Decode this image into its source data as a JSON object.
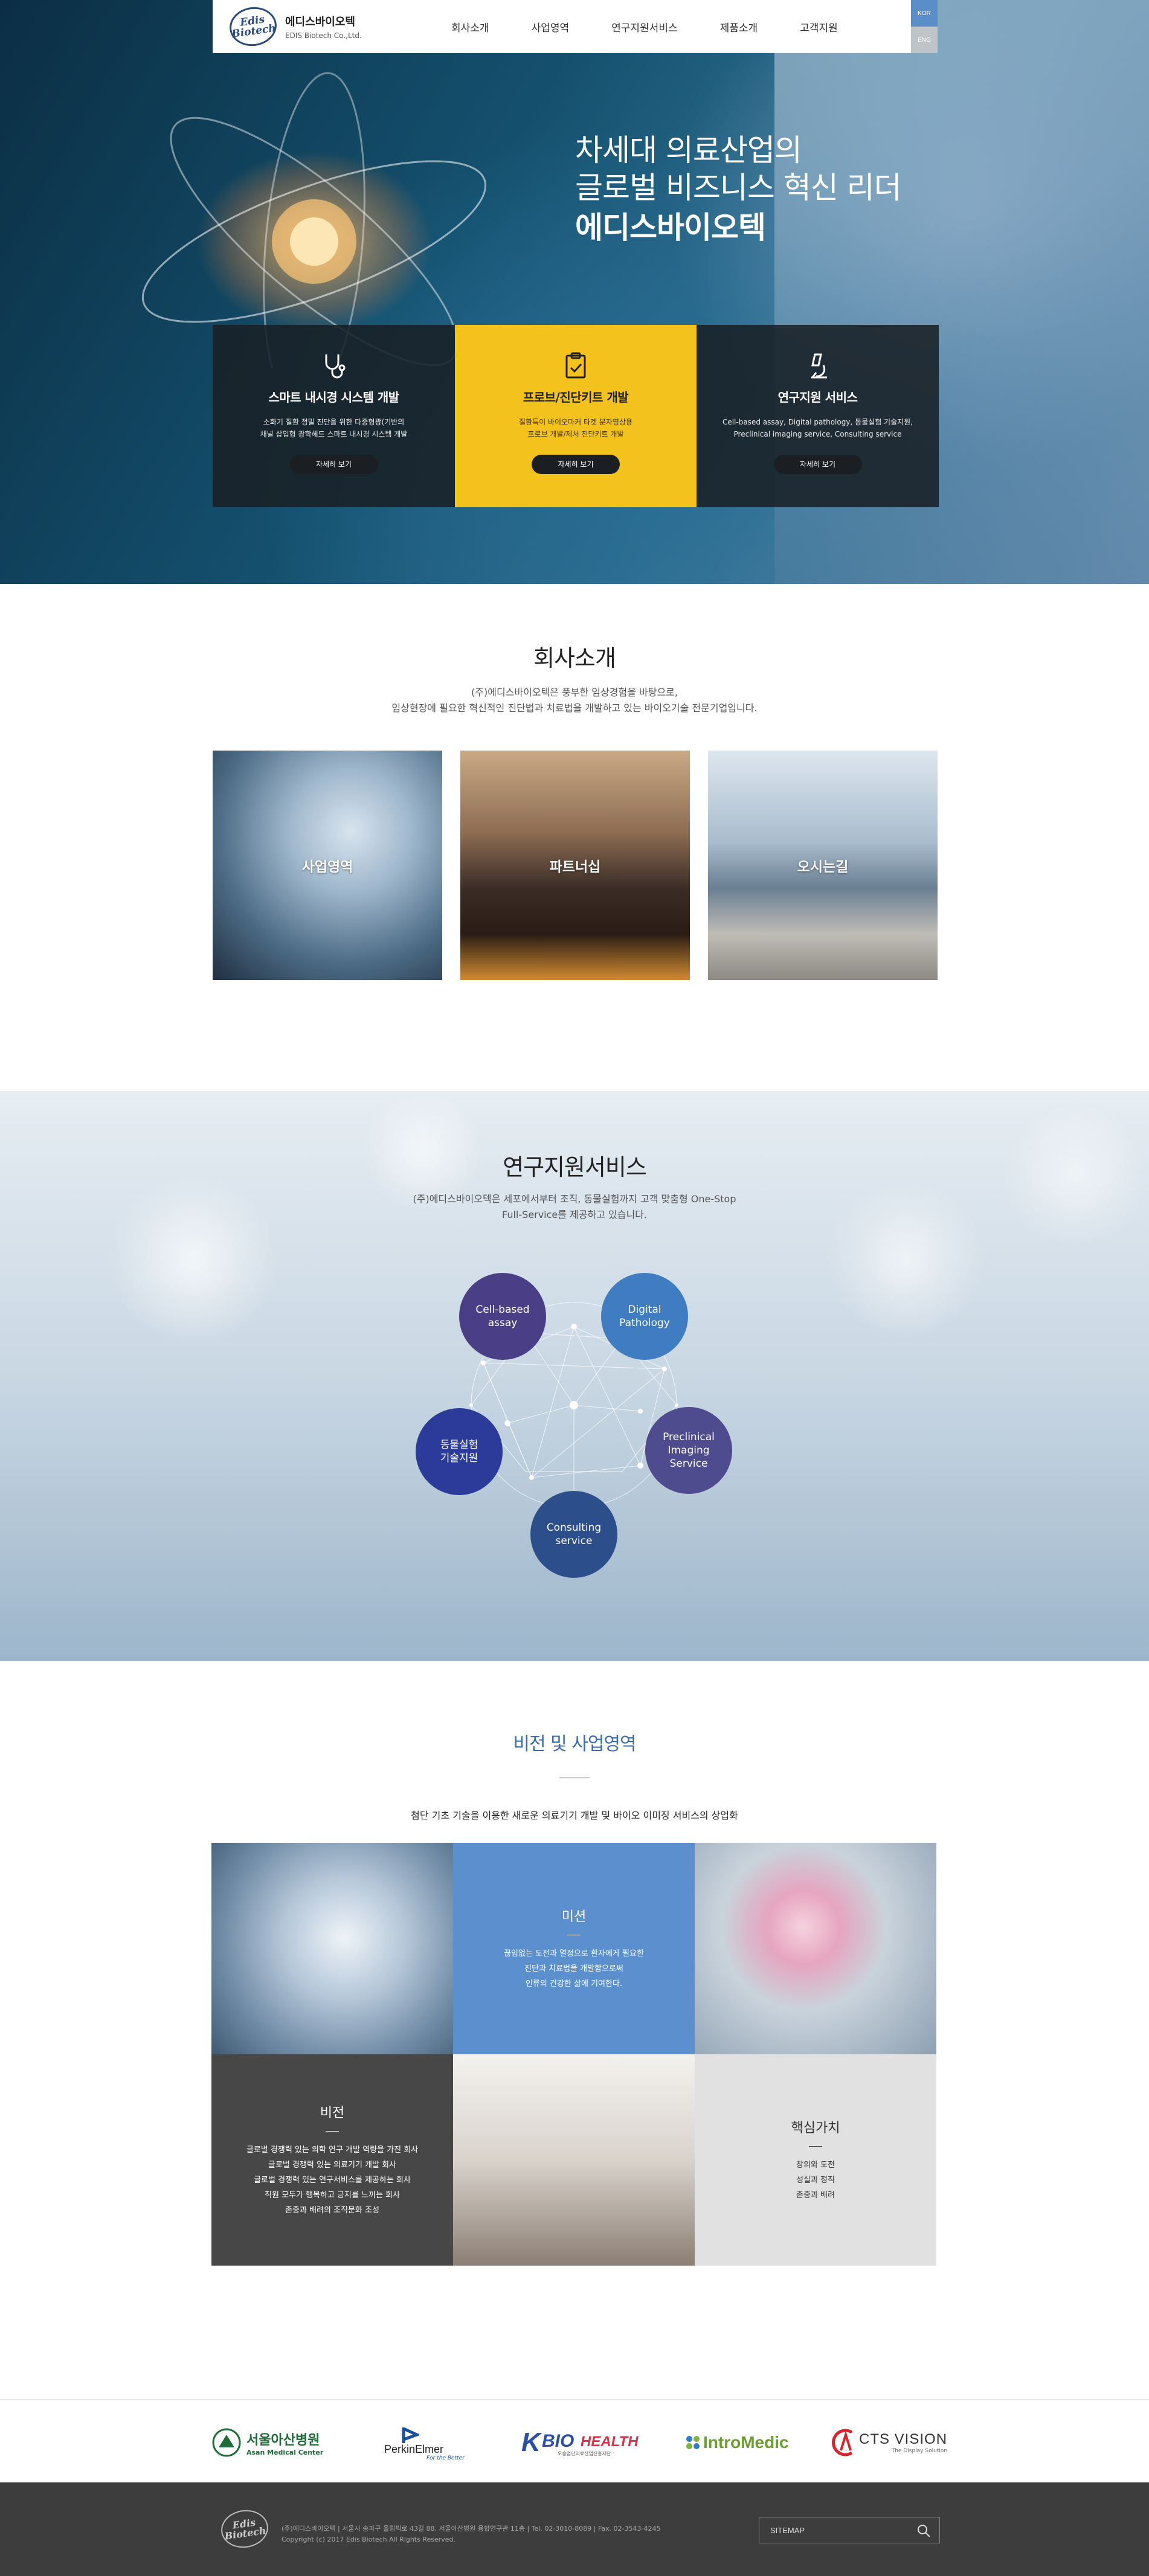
{
  "header": {
    "logo_mark_1": "Edis",
    "logo_mark_2": "Biotech",
    "logo_korean": "에디스바이오텍",
    "logo_english": "EDIS Biotech Co.,Ltd.",
    "nav": [
      "회사소개",
      "사업영역",
      "연구지원서비스",
      "제품소개",
      "고객지원"
    ],
    "lang_kor": "KOR",
    "lang_eng": "ENG"
  },
  "hero": {
    "line1": "차세대 의료산업의",
    "line2": "글로벌 비즈니스 혁신 리더",
    "line3": "에디스바이오텍",
    "cards": [
      {
        "icon": "stethoscope-icon",
        "title": "스마트 내시경 시스템 개발",
        "desc1": "소화기 질환 정밀 진단을 위한 다중형광(기반의",
        "desc2": "채널 삽입형 광학헤드 스마트 내시경 시스템 개발",
        "more": "자세히 보기"
      },
      {
        "icon": "clipboard-icon",
        "title": "프로브/진단키트 개발",
        "desc1": "질환특이 바이오마커 타겟 분자영상용",
        "desc2": "프로브 개발/제처 진단키트 개발",
        "more": "자세히 보기"
      },
      {
        "icon": "microscope-icon",
        "title": "연구지원 서비스",
        "desc1": "Cell-based assay, Digital pathology, 동물실험 기술지원,",
        "desc2": "Preclinical imaging service, Consulting service",
        "more": "자세히 보기"
      }
    ]
  },
  "company": {
    "title": "회사소개",
    "desc1": "(주)에디스바이오텍은 풍부한 임상경험을 바탕으로,",
    "desc2": "임상현장에 필요한 혁신적인 진단법과 치료법을 개발하고 있는 바이오기술 전문기업입니다.",
    "tiles": [
      "사업영역",
      "파트너십",
      "오시는길"
    ]
  },
  "research": {
    "title": "연구지원서비스",
    "desc1": "(주)에디스바이오텍은 세포에서부터 조직, 동물실험까지 고객 맞춤형 One-Stop",
    "desc2": "Full-Service를 제공하고 있습니다.",
    "services": [
      {
        "l1": "Cell-based",
        "l2": "assay"
      },
      {
        "l1": "Digital",
        "l2": "Pathology"
      },
      {
        "l1": "동물실험",
        "l2": "기술지원"
      },
      {
        "l1": "Preclinical",
        "l2": "Imaging",
        "l3": "Service"
      },
      {
        "l1": "Consulting",
        "l2": "service"
      }
    ]
  },
  "vision": {
    "title": "비전 및 사업영역",
    "subtitle": "첨단 기초 기술을 이용한 새로운 의료기기 개발 및 바이오 이미징 서비스의 상업화",
    "mission_title": "미션",
    "mission_lines": [
      "끊임없는 도전과 열정으로 환자에게 필요한",
      "진단과 치료법을 개발함으로써",
      "인류의 건강한 삶에 기여한다."
    ],
    "vision_title": "비전",
    "vision_lines": [
      "글로벌 경쟁력 있는 의학 연구 개발 역량을 가진 회사",
      "글로벌 경쟁력 있는 의료기기 개발 회사",
      "글로벌 경쟁력 있는 연구서비스를 제공하는 회사",
      "직원 모두가 행복하고 긍지를 느끼는 회사",
      "존중과 배려의 조직문화 조성"
    ],
    "value_title": "핵심가치",
    "value_lines": [
      "창의와 도전",
      "성실과 정직",
      "존중과 배려"
    ]
  },
  "partners": {
    "asan_ko": "서울아산병원",
    "asan_en": "Asan Medical Center",
    "perkin": "PerkinElmer",
    "perkin_tag": "For the Better",
    "kbio_k": "K",
    "kbio": "BIO",
    "kbio_health": "HEALTH",
    "kbio_sub": "오송첨단의료산업진흥재단",
    "intro": "IntroMedic",
    "cts": "CTS VISION",
    "cts_sub": "The Display Solution"
  },
  "footer": {
    "logo_1": "Edis",
    "logo_2": "Biotech",
    "info1": "(주)에디스바이오텍 | 서울시 송파구 올림픽로 43길 88, 서울아산병원 융합연구관 11층 | Tel. 02-3010-8089 | Fax. 02-3543-4245",
    "info2": "Copyright (c) 2017 Edis Biotech All Rights Reserved.",
    "sitemap": "SITEMAP"
  }
}
